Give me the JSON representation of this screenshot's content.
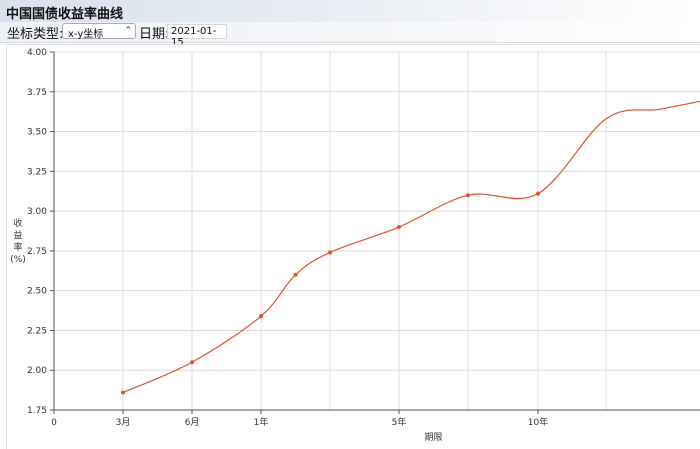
{
  "window": {
    "title": "中国国债收益率曲线"
  },
  "toolbar": {
    "coord_label": "坐标类型:",
    "coord_value": "x-y坐标",
    "date_label": "日期:",
    "date_value": "2021-01-15"
  },
  "colors": {
    "line": "#e0522a",
    "grid": "#dcdcdc",
    "axis": "#555555"
  },
  "icons": {
    "select_arrow": "chevron-updown-icon"
  },
  "chart_data": {
    "type": "line",
    "title": "",
    "xlabel": "期限",
    "ylabel": "收益率(%)",
    "x_unit": "years",
    "xlim": [
      0,
      11.5
    ],
    "ylim": [
      1.75,
      4.0
    ],
    "y_ticks": [
      "1.75",
      "2.00",
      "2.25",
      "2.50",
      "2.75",
      "3.00",
      "3.25",
      "3.50",
      "3.75",
      "4.00"
    ],
    "x_ticks": [
      {
        "value": 0,
        "label": "0"
      },
      {
        "value": 0.25,
        "label": "3月"
      },
      {
        "value": 0.5,
        "label": "6月"
      },
      {
        "value": 1,
        "label": "1年"
      },
      {
        "value": 5,
        "label": "5年"
      },
      {
        "value": 10,
        "label": "10年"
      }
    ],
    "x_grid": [
      0.25,
      0.5,
      1,
      3,
      5,
      7,
      10,
      15
    ],
    "grid": true,
    "series": [
      {
        "name": "",
        "points": [
          {
            "x": 0.25,
            "y": 1.86
          },
          {
            "x": 0.5,
            "y": 2.05
          },
          {
            "x": 1,
            "y": 2.34
          },
          {
            "x": 2,
            "y": 2.6
          },
          {
            "x": 3,
            "y": 2.74
          },
          {
            "x": 5,
            "y": 2.9
          },
          {
            "x": 7,
            "y": 3.1
          },
          {
            "x": 10,
            "y": 3.11
          },
          {
            "x": 15,
            "y": 3.58
          },
          {
            "x": 20,
            "y": 3.64
          },
          {
            "x": 30,
            "y": 3.69
          }
        ],
        "markers": [
          0.25,
          0.5,
          1,
          2,
          3,
          5,
          7,
          10
        ]
      }
    ]
  }
}
